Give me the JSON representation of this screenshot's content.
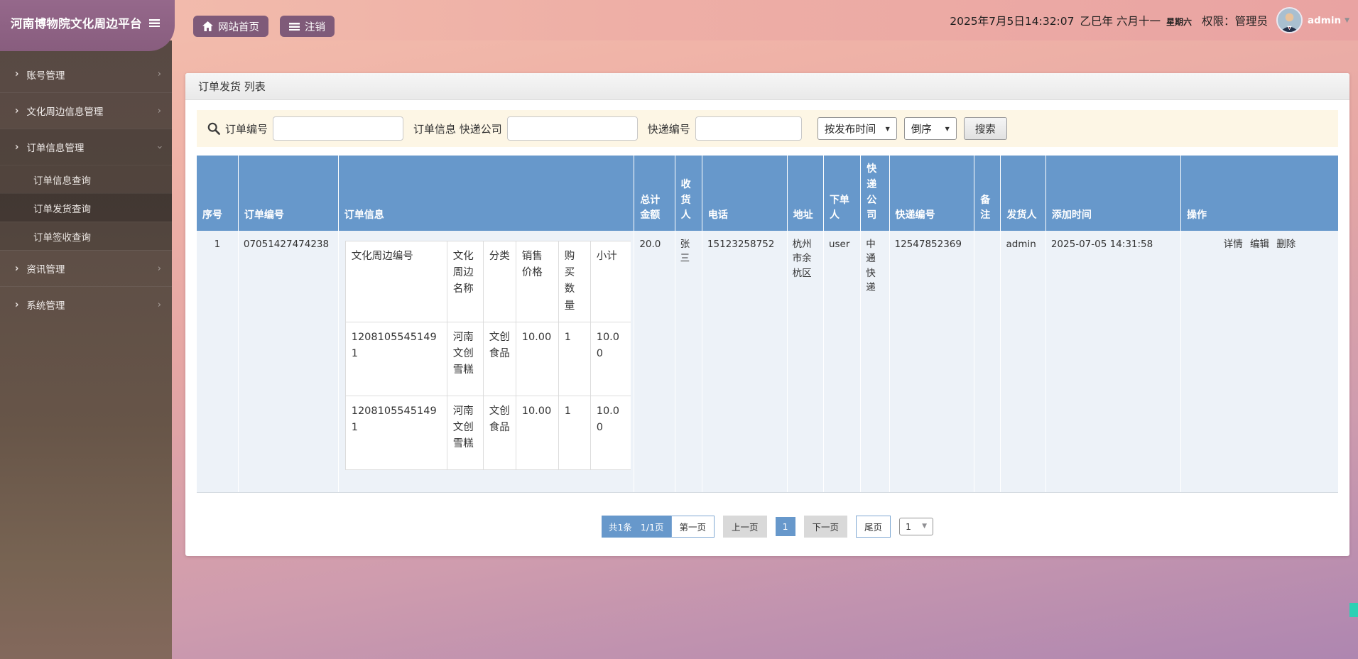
{
  "icons": {
    "menu": "☰",
    "chevron_right": "›",
    "caret_down": "▼"
  },
  "header": {
    "brand": "河南博物院文化周边平台",
    "home_button": "网站首页",
    "logout_button": "注销",
    "datetime": "2025年7月5日14:32:07",
    "lunar_date": "乙巳年 六月十一",
    "weekday": "星期六",
    "role": "权限：管理员",
    "username": "admin"
  },
  "sidebar": {
    "items": [
      {
        "label": "账号管理"
      },
      {
        "label": "文化周边信息管理"
      },
      {
        "label": "订单信息管理"
      },
      {
        "label": "订单信息查询"
      },
      {
        "label": "订单发货查询"
      },
      {
        "label": "订单签收查询"
      },
      {
        "label": "资讯管理"
      },
      {
        "label": "系统管理"
      }
    ]
  },
  "page": {
    "title": "订单发货 列表"
  },
  "search": {
    "order_no_label": "订单编号",
    "order_info_express_label": "订单信息 快递公司",
    "express_no_label": "快递编号",
    "sort_field": "按发布时间",
    "sort_order": "倒序",
    "search_button": "搜索"
  },
  "table": {
    "headers": [
      "序号",
      "订单编号",
      "订单信息",
      "总计金额",
      "收货人",
      "电话",
      "地址",
      "下单人",
      "快递公司",
      "快递编号",
      "备注",
      "发货人",
      "添加时间",
      "操作"
    ],
    "row": {
      "index": "1",
      "order_no": "07051427474238",
      "total": "20.0",
      "receiver": "张三",
      "phone": "15123258752",
      "address": "杭州市余杭区",
      "buyer": "user",
      "express_company": "中通快递",
      "express_no": "12547852369",
      "remark": "",
      "shipper": "admin",
      "add_time": "2025-07-05 14:31:58",
      "action_detail": "详情",
      "action_edit": "编辑",
      "action_delete": "删除"
    },
    "inner": {
      "headers": [
        "文化周边编号",
        "文化周边名称",
        "分类",
        "销售价格",
        "购买数量",
        "小计"
      ],
      "rows": [
        {
          "no": "12081055451491",
          "name": "河南文创雪糕",
          "category": "文创食品",
          "price": "10.00",
          "qty": "1",
          "subtotal": "10.00"
        },
        {
          "no": "12081055451491",
          "name": "河南文创雪糕",
          "category": "文创食品",
          "price": "10.00",
          "qty": "1",
          "subtotal": "10.00"
        }
      ]
    }
  },
  "pagination": {
    "total": "共1条",
    "page_info": "1/1页",
    "first": "第一页",
    "prev": "上一页",
    "current": "1",
    "next": "下一页",
    "last": "尾页",
    "page_select": "1"
  },
  "colors": {
    "table_header_blue": "#6798cb",
    "accent_purple": "#7f5a79",
    "header_pink": "#efb2a7",
    "search_bg": "#fdf6e5",
    "scroll_indicator_teal": "#2bd0b4"
  }
}
